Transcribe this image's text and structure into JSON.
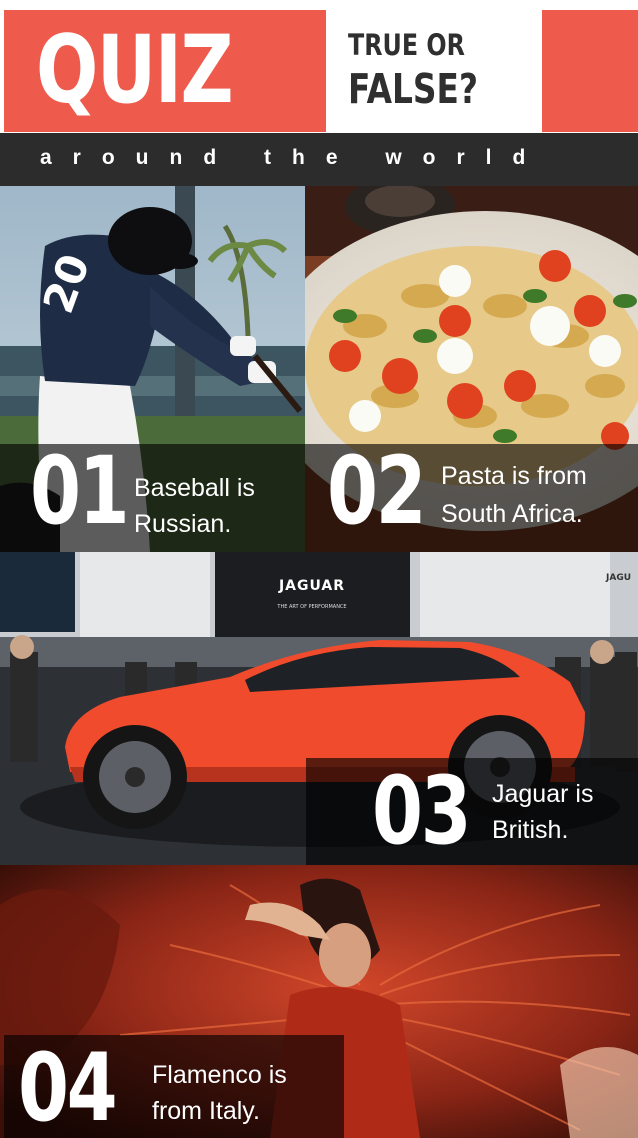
{
  "header": {
    "title": "QUIZ",
    "tag_line1": "TRUE OR",
    "tag_line2": "FALSE?",
    "subtitle": "around the world"
  },
  "colors": {
    "accent": "#ee5b4c",
    "dark_bar": "#2c2c2c",
    "text_light": "#ffffff",
    "text_dark": "#2f2f2f"
  },
  "items": [
    {
      "number": "01",
      "statement_line1": "Baseball is",
      "statement_line2": "Russian.",
      "image": "baseball-batter-photo"
    },
    {
      "number": "02",
      "statement_line1": "Pasta is from",
      "statement_line2": "South Africa.",
      "image": "farfalle-pasta-dish-photo"
    },
    {
      "number": "03",
      "statement_line1": "Jaguar is",
      "statement_line2": "British.",
      "image": "red-jaguar-car-photo"
    },
    {
      "number": "04",
      "statement_line1": "Flamenco is",
      "statement_line2": "from Italy.",
      "image": "flamenco-dancer-photo"
    }
  ],
  "photo_text": {
    "jaguar_logo": "JAGUAR",
    "jaguar_slogan": "THE ART OF PERFORMANCE",
    "jaguar_logo_right": "JAGU"
  }
}
